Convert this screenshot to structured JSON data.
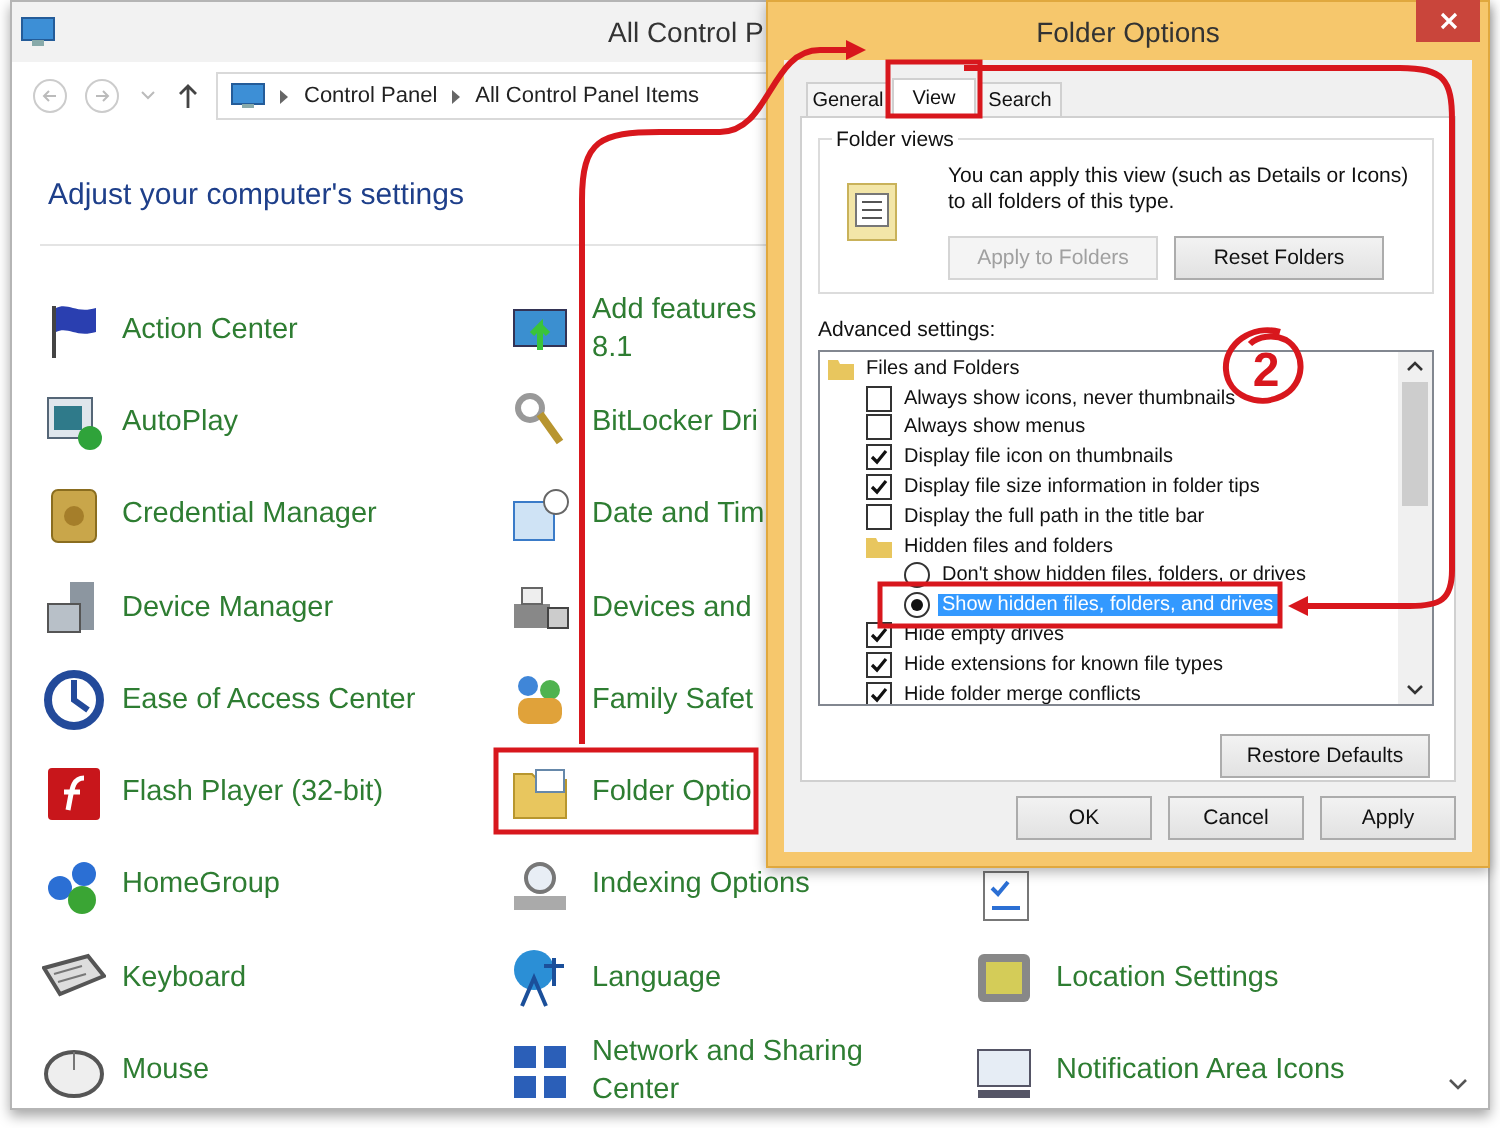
{
  "window": {
    "title": "All Control P",
    "breadcrumb": [
      "Control Panel",
      "All Control Panel Items"
    ]
  },
  "heading": "Adjust your computer's settings",
  "columns": [
    {
      "items": [
        {
          "kind": "link",
          "label": "Action Center"
        },
        {
          "kind": "link",
          "label": "AutoPlay"
        },
        {
          "kind": "link",
          "label": "Credential Manager"
        },
        {
          "kind": "link",
          "label": "Device Manager"
        },
        {
          "kind": "link",
          "label": "Ease of Access Center"
        },
        {
          "kind": "link",
          "label": "Flash Player (32-bit)"
        },
        {
          "kind": "link",
          "label": "HomeGroup"
        },
        {
          "kind": "link",
          "label": "Keyboard"
        },
        {
          "kind": "link",
          "label": "Mouse"
        }
      ]
    },
    {
      "items": [
        {
          "kind": "link",
          "label": "Add features\n8.1"
        },
        {
          "kind": "link",
          "label": "BitLocker Dri"
        },
        {
          "kind": "link",
          "label": "Date and Tim"
        },
        {
          "kind": "link",
          "label": "Devices and"
        },
        {
          "kind": "link",
          "label": "Family Safet"
        },
        {
          "kind": "link",
          "label": "Folder Optio"
        },
        {
          "kind": "link",
          "label": "Indexing Options"
        },
        {
          "kind": "link",
          "label": "Language"
        },
        {
          "kind": "link",
          "label": "Network and Sharing\nCenter"
        }
      ]
    },
    {
      "items": [
        {
          "kind": "icon"
        },
        {
          "kind": "link",
          "label": "Location Settings"
        },
        {
          "kind": "link",
          "label": "Notification Area Icons"
        }
      ]
    }
  ],
  "dialog": {
    "title": "Folder Options",
    "tabs": [
      {
        "label": "General",
        "selected": false
      },
      {
        "label": "View",
        "selected": true
      },
      {
        "label": "Search",
        "selected": false
      }
    ],
    "folder_views": {
      "title": "Folder views",
      "text": "You can apply this view (such as Details or Icons) to all folders of this type.",
      "buttons": [
        {
          "label": "Apply to Folders",
          "disabled": true
        },
        {
          "label": "Reset Folders",
          "disabled": false
        }
      ]
    },
    "advanced_label": "Advanced settings:",
    "advanced_settings": [
      {
        "kind": "folder",
        "label": "Files and Folders",
        "children": [
          {
            "kind": "checkbox",
            "label": "Always show icons, never thumbnails",
            "checked": false
          },
          {
            "kind": "checkbox",
            "label": "Always show menus",
            "checked": false
          },
          {
            "kind": "checkbox",
            "label": "Display file icon on thumbnails",
            "checked": true
          },
          {
            "kind": "checkbox",
            "label": "Display file size information in folder tips",
            "checked": true
          },
          {
            "kind": "checkbox",
            "label": "Display the full path in the title bar",
            "checked": false
          },
          {
            "kind": "folder",
            "label": "Hidden files and folders",
            "children": [
              {
                "kind": "radio",
                "label": "Don't show hidden files, folders, or drives",
                "selected": false
              },
              {
                "kind": "radio",
                "label": "Show hidden files, folders, and drives",
                "selected": true
              }
            ]
          },
          {
            "kind": "checkbox",
            "label": "Hide empty drives",
            "checked": true
          },
          {
            "kind": "checkbox",
            "label": "Hide extensions for known file types",
            "checked": true
          },
          {
            "kind": "checkbox",
            "label": "Hide folder merge conflicts",
            "checked": true
          }
        ]
      }
    ],
    "restore_button": "Restore Defaults",
    "footer_buttons": [
      "OK",
      "Cancel",
      "Apply"
    ]
  },
  "annotation": {
    "step_number": "2"
  }
}
